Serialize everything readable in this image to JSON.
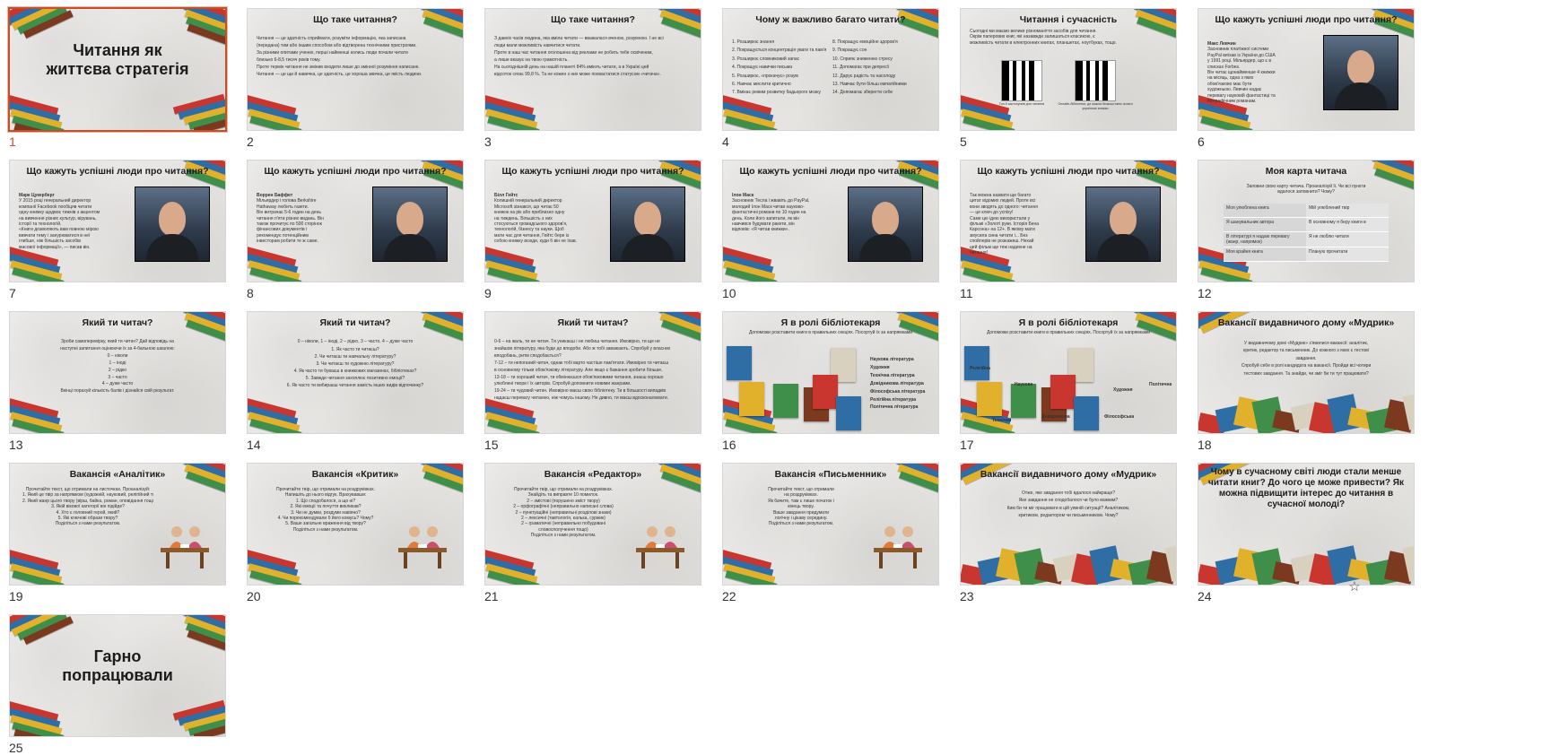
{
  "slides": [
    {
      "num": "1",
      "title": "Читання як життєва стратегія",
      "variant": "cover",
      "selected": true
    },
    {
      "num": "2",
      "title": "Що таке читання?",
      "variant": "text",
      "lines": [
        "Читання — це здатність сприймати, розуміти інформацію, яка записана",
        "(передана) тим або іншим способом або відтворена технічними пристроями.",
        "За різними опитами учених, перші найменші колись люди почали читати",
        "близько 6-8,5 тисяч років тому.",
        "Проте термін читання не змінив входити лише до змінної розуміння написане.",
        "Читання — це щи й навичка, це здатність, це хороша звичка, це якість людини."
      ]
    },
    {
      "num": "3",
      "title": "Що таке читання?",
      "variant": "text",
      "lines": [
        "З давніх часів людина, яка вміла читати — вважалася вченою, розумною. І не всі",
        "люди мали можливість навчитися читати.",
        "Проте в наш час читання оголошена від реклами не робить тебе освіченим,",
        "а лише вказує на твою грамотність.",
        "На сьогоднішній день на нашій планеті 84% вміють читати, а в Україні цей",
        "відсоток сягає 99,8 %. Та не кожен з них може похвастатися статусом «читача»."
      ]
    },
    {
      "num": "4",
      "title": "Чому ж важливо багато читати?",
      "variant": "twocol",
      "left": [
        "1. Розширює знання",
        "2. Покращується концентрація уваги та пам'ять",
        "3. Розширює словниковий запас",
        "4. Покращує навички письма",
        "5. Розширює, «прокачує» розум",
        "6. Навчає мислити критично",
        "7. Вмікає режим розвитку бадьорого мозку"
      ],
      "right": [
        "8. Покращує емоційне здоров'я",
        "9. Покращує сон",
        "10. Сприяє зниженню стресу",
        "11. Допомагає при депресії",
        "12. Дарує радість та насолоду",
        "13. Навчає бути більш емпатійними",
        "14. Допомагає зберегти себе"
      ]
    },
    {
      "num": "5",
      "title": "Читання і сучасність",
      "variant": "qr",
      "lines": [
        "Сьогодні ми маємо велике різноманіття засобів для читання.",
        "Окрім паперових книг, які назавжди залишаться класикою, є",
        "можливість читати в електронних книгах, планшетах, ноутбуках, тощо."
      ],
      "qr_captions": [
        "Топ-5 застосунків для читання",
        "Онлайн-бібліотеки, де можна безкоштовно читати українські книжки"
      ]
    },
    {
      "num": "6",
      "title": "Що кажуть успішні люди про читання?",
      "variant": "person",
      "name": "Макс Левчин",
      "lines": [
        "Засновник платіжної системи",
        "PayPal виїхав із України до США",
        "у 1991 році. Мільярдер, що є в",
        "списках Forbes.",
        "Він читає щонайменше 4 книжки",
        "на місяць, одна з яких",
        "обов'язково має бути",
        "художньою. Левчин надає",
        "перевагу науковій фантастиці та",
        "біографічним романам."
      ]
    },
    {
      "num": "7",
      "title": "Що кажуть успішні люди про читання?",
      "variant": "person",
      "name": "Марк Цукерберг",
      "lines": [
        "У 2015 році генеральний директор",
        "компанії Facebook пообіцяв читати",
        "одну книжку щодвоє тижнів з акцентом",
        "на вивчення різних культур, вірувань,",
        "історії та технологій.",
        "«Книги дозволяють вам повною мірою",
        "вивчати тему і занурюватися в неї",
        "глибше, ніж більшість засобів",
        "масової інформації», — писав він."
      ]
    },
    {
      "num": "8",
      "title": "Що кажуть успішні люди про читання?",
      "variant": "person",
      "name": "Воррен Баффет",
      "lines": [
        "Мільярдер і голова Berkshire",
        "Hathaway любить газети.",
        "Він витрачає 5-6 годин на день",
        "читання п'яти різних видань. Він",
        "також прочитує по 500 сторінок",
        "фінансових документів і",
        "рекомендує потенційним",
        "інвесторам робити те ж саме."
      ]
    },
    {
      "num": "9",
      "title": "Що кажуть успішні люди про читання?",
      "variant": "person",
      "name": "Білл Гейтс",
      "lines": [
        "Колишній генеральний директор",
        "Microsoft зізнався, що читає 50",
        "книжок на рік або приблизно одну",
        "на тиждень. Більшість з них",
        "стосуються громадського здоров'я,",
        "технологій, бізнесу та науки. Щоб",
        "мати час для читання, Гейтс бере із",
        "собою книжку всюди, куди б він не їхав."
      ]
    },
    {
      "num": "10",
      "title": "Що кажуть успішні люди про читання?",
      "variant": "person",
      "name": "Ілон Маск",
      "lines": [
        "Засновник Тесла і жвавіть до PayPal,",
        "молодий Ілон Маск читав науково-",
        "фантастичні романи по 10 годин на",
        "день. Коли його запитали, як він",
        "навчився будувати ракети, він",
        "відповів: «Я читав книжки»."
      ]
    },
    {
      "num": "11",
      "title": "Що кажуть успішні люди про читання?",
      "variant": "person",
      "name": "",
      "lines": [
        "Так можна назвати ще багато",
        "цитат відомих людей. Проте всі",
        "вони зводять до одного: читання",
        "— це ключ до успіху!",
        "Саме цю ідею використали у",
        "фільмі «Золоті руки. Історія Бена",
        "Карсона» на 12+. В якому мати",
        "змусила сина читати і... Без",
        "спойлерів не розкажеш. Нехай",
        "цей фільм ще теж надихне на",
        "читання!"
      ]
    },
    {
      "num": "12",
      "title": "Моя карта читача",
      "variant": "table",
      "lines": [
        "Заповни свою карту читача. Проаналізуй її. Чи всі пункти",
        "вдалося заповнити? Чому?"
      ],
      "rows": [
        [
          "Моя улюблена книга",
          "Мій улюблений твір"
        ],
        [
          "Я шанувальник автора",
          "В основному я беру книги в"
        ],
        [
          "В літературі я надаю перевагу (жанр, напрямок)",
          "Я не люблю читати"
        ],
        [
          "Моя крайня книга",
          "Планую прочитати"
        ]
      ]
    },
    {
      "num": "13",
      "title": "Який ти читач?",
      "variant": "text",
      "lines": [
        "Зроби самоперевірку, який ти читач? Дай відповідь на",
        "наступні запитання оцінюючи їх за 4-бальною шкалою:",
        "0 – ніколи",
        "1 – іноді",
        "2 – рідко",
        "3 – часто",
        "4 – дуже часто",
        "Вкінці порахуй кількість балів і дізнайся свій результат."
      ]
    },
    {
      "num": "14",
      "title": "Який ти читач?",
      "variant": "text",
      "lines": [
        "0 – ніколи,   1 – іноді,   2 – рідко,   3 – часто,   4 – дуже часто",
        "",
        "1. Як часто ти читаєш?",
        "2. Чи читаєш ти навчальну літературу?",
        "3. Чи читаєш ти художню літературу?",
        "4. Як часто ти буваєш в книжкових магазинах, бібліотеках?",
        "5. Завжди читання захоплює позитивно емоції?",
        "6. Як часто ти вибираєш читання замість інших видів відпочинку?"
      ]
    },
    {
      "num": "15",
      "title": "Який ти читач?",
      "variant": "text",
      "lines": [
        "0-6 – на жаль, ти не читач. Ти уникаєш і не любиш читання. Ймовірно, ти ще не",
        "знайшов літературу, яка буде до вподоби. Або ж тобі заважають. Спробуй у власних",
        "вподобань, ритм сподобається?",
        "7-12 – ти непоганий читач, однак тобі варто частіше пам'ятати. Ймовірно ти читаєш",
        "в основному тільки обов'язкову літературу. Але якщо є бажання зробити більше.",
        "13-18 – ти хороший читач, ти обмінюєшся обов'язковими читання, знаєш хорошо",
        "улюблені твори і їх авторів. Спробуй доповнити новими жанрами.",
        "19-24 – ти чудовий читач. Ймовірно маєш свою бібліотеку. Ти в більшості випадків",
        "надаєш перевагу читанню, ніж чомусь іншому. Не дивно, ти маєш вдосконалювати."
      ]
    },
    {
      "num": "16",
      "title": "Я в ролі бібліотекаря",
      "variant": "books",
      "lines": [
        "Допоможи розставити книги в правильних секціях. Посортуй їх за напрямками"
      ],
      "labels": [
        "Наукова література",
        "Художня",
        "Технічна література",
        "Довідникова література",
        "Філософська література",
        "Релігійна література",
        "Політична література"
      ]
    },
    {
      "num": "17",
      "title": "Я в ролі бібліотекаря",
      "variant": "books2",
      "lines": [
        "Допоможи розставити книги в правильних секціях. Посортуй їх за напрямками"
      ],
      "labels": [
        "Релігійна",
        "Наукова",
        "Довідникова",
        "Технічна",
        "Художня",
        "Філософська",
        "Політична"
      ]
    },
    {
      "num": "18",
      "title": "Вакансії видавничого дому «Мудрик»",
      "variant": "plain",
      "lines": [
        "У видавничому домі «Мудрик» з'явилися вакансії: аналітик,",
        "критик, редактор та письменник. До кожного з яких є тестові",
        "завдання.",
        "Спробуй себе в ролі кандидата на вакансії. Пройди всі чотири",
        "тестових завдання. Та знайди, чи зміг би ти тут працювати?"
      ]
    },
    {
      "num": "19",
      "title": "Вакансія «Аналітик»",
      "variant": "people",
      "lines": [
        "Прочитайте текст, що отримали на листочках. Проаналізуй:",
        "1. Який це твір за напрямком (художній, науковий, релігійний тощо)?",
        "2. Який жанр цього твору (вірш, байка, роман, оповідання тощо)?",
        "3. Якій вікової категорії він підійде?",
        "4. Хто є головний герой, який?",
        "5. Які ключові образи твору?",
        "Поділіться з нами результатом."
      ]
    },
    {
      "num": "20",
      "title": "Вакансія «Критик»",
      "variant": "people",
      "lines": [
        "Прочитайте твір, що отримали на роздруківках.",
        "Напишіть до нього відгук. Врахувавши:",
        "1. Що сподобалося, а що ні?",
        "2. Які емоції та почуття викликав?",
        "3. Чи не думки, роздуми навіяно?",
        "4. Чи порекомендували б його комусь? Чому?",
        "5. Ваше загальне враження від твору?",
        "Поділіться з нами результатом."
      ]
    },
    {
      "num": "21",
      "title": "Вакансія «Редактор»",
      "variant": "people",
      "lines": [
        "Прочитайте твір, що отримали на роздруківках.",
        "Знайдіть та виправте 10 помилок.",
        "2 – змістові (порушено зміст твору)",
        "2 – орфографічні (неправильно написані слова)",
        "2 – пунктуаційні (неправильні розділові знаки)",
        "2 – лексичні (тавтологія, калька, суржик)",
        "2 – граматичні (неправильно побудовані",
        "словосполучення тощо)",
        "Поділіться з нами результатом."
      ]
    },
    {
      "num": "22",
      "title": "Вакансія «Письменник»",
      "variant": "people",
      "lines": [
        "Прочитайте текст, що отримали",
        "на роздруківках.",
        "Як бачите, там є лише початок і",
        "кінець твору.",
        "Ваше завдання придумати",
        "логічну і цікаву середину.",
        "Поділіться з нами результатом."
      ]
    },
    {
      "num": "23",
      "title": "Вакансії видавничого дому «Мудрик»",
      "variant": "plain",
      "lines": [
        "Отже, яке завдання тобі вдалося найкраще?",
        "Яке завдання не сподобалося чи було важким?",
        "Ким би ти міг працювати в цій уявній ситуації? Аналітиком,",
        "критиком, редактором чи письменником. Чому?"
      ]
    },
    {
      "num": "24",
      "title": "Чому в сучасному світі люди стали менше читати книг? До чого це може привести? Як можна підвищити інтерес до читання в сучасної молоді?",
      "variant": "question",
      "lines": []
    },
    {
      "num": "25",
      "title": "Гарно попрацювали",
      "variant": "cover",
      "lines": []
    }
  ],
  "colors": {
    "accent": "#c4502b",
    "book_colors": [
      "#c9362f",
      "#2f6ea5",
      "#e1b12c",
      "#3f8f4a",
      "#7b3a1f",
      "#d9d1bf"
    ]
  },
  "icons": {
    "star": "star-icon"
  }
}
